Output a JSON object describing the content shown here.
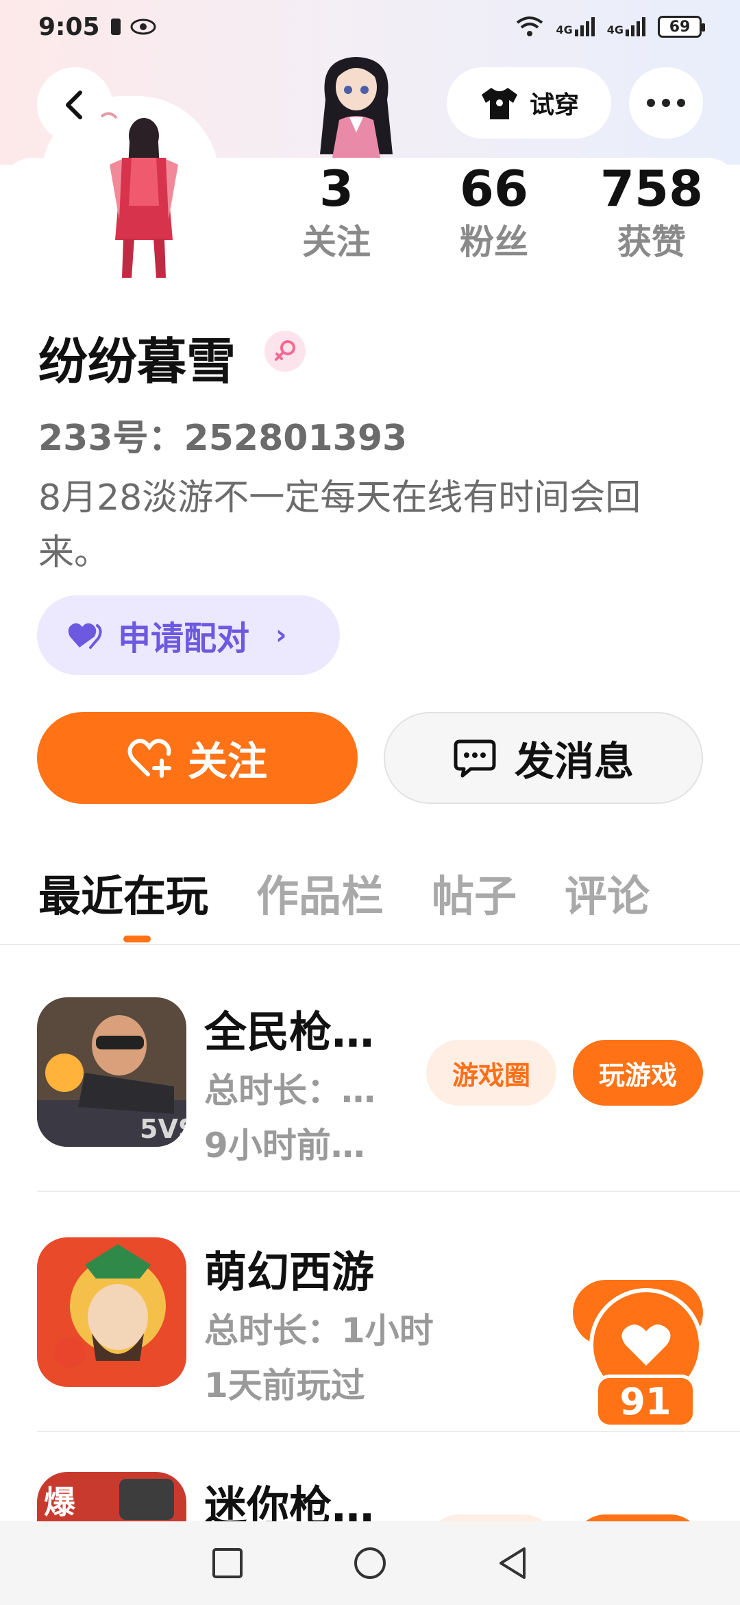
{
  "status_bar": {
    "time": "9:05",
    "battery": "69",
    "signal_1": "4G",
    "signal_2": "4G"
  },
  "header": {
    "tryon_label": "试穿"
  },
  "stats": [
    {
      "value": "3",
      "label": "关注"
    },
    {
      "value": "66",
      "label": "粉丝"
    },
    {
      "value": "758",
      "label": "获赞"
    }
  ],
  "profile": {
    "nickname": "纷纷暮雪",
    "id_line": "233号：252801393",
    "bio": "8月28淡游不一定每天在线有时间会回来。",
    "pair_label": "申请配对"
  },
  "actions": {
    "follow_label": "关注",
    "message_label": "发消息"
  },
  "tabs": [
    "最近在玩",
    "作品栏",
    "帖子",
    "评论"
  ],
  "games": [
    {
      "title": "全民枪…",
      "line1": "总时长：…",
      "line2": "9小时前…",
      "circle_label": "游戏圈",
      "play_label": "玩游戏"
    },
    {
      "title": "萌幻西游",
      "line1": "总时长：1小时",
      "line2": "1天前玩过"
    },
    {
      "title": "迷你枪…"
    }
  ],
  "like_fab": {
    "count": "91"
  },
  "colors": {
    "accent": "#ff7316",
    "pair_purple": "#6d58e0"
  }
}
